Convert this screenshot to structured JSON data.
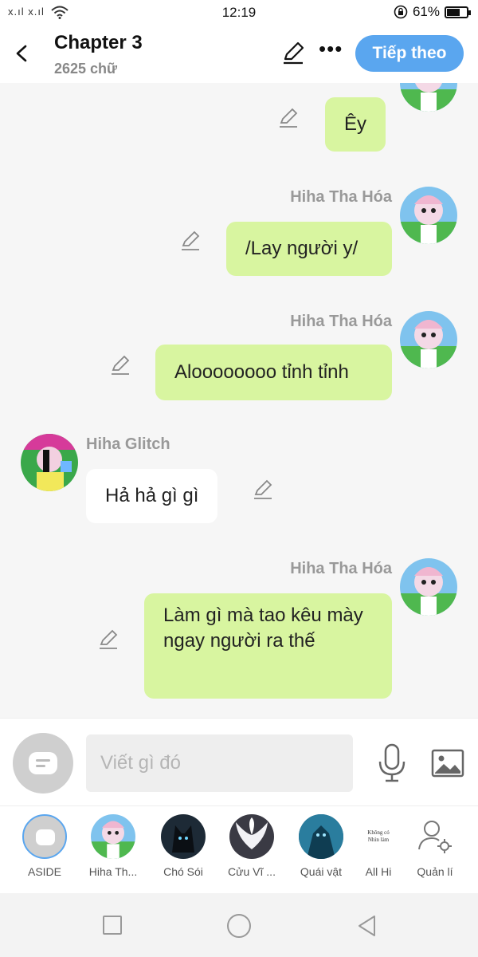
{
  "status": {
    "signal": "x.ıl x.ıl",
    "time": "12:19",
    "battery": "61%"
  },
  "header": {
    "title": "Chapter 3",
    "word_count": "2625 chữ",
    "next_label": "Tiếp theo"
  },
  "messages": [
    {
      "side": "mine",
      "sender": "",
      "text": "Êy"
    },
    {
      "side": "mine",
      "sender": "Hiha Tha Hóa",
      "text": "/Lay người y/"
    },
    {
      "side": "mine",
      "sender": "Hiha Tha Hóa",
      "text": "Aloooooooo tỉnh tỉnh"
    },
    {
      "side": "other",
      "sender": "Hiha Glitch",
      "text": "Hả hả gì gì"
    },
    {
      "side": "mine",
      "sender": "Hiha Tha Hóa",
      "text": "Làm gì mà tao kêu mày ngay người ra thế"
    }
  ],
  "composer": {
    "placeholder": "Viết gì đó"
  },
  "characters": [
    {
      "label": "ASIDE"
    },
    {
      "label": "Hiha Th..."
    },
    {
      "label": "Chó Sói"
    },
    {
      "label": "Cửu Vĩ ..."
    },
    {
      "label": "Quái vật"
    },
    {
      "label": "All Hi",
      "thumb_text": "Không có Nhìn làm"
    },
    {
      "label": "Quản lí"
    }
  ],
  "colors": {
    "accent": "#5aa6ef",
    "my_bubble": "#d8f5a0",
    "other_bubble": "#ffffff",
    "background": "#f6f6f6"
  }
}
